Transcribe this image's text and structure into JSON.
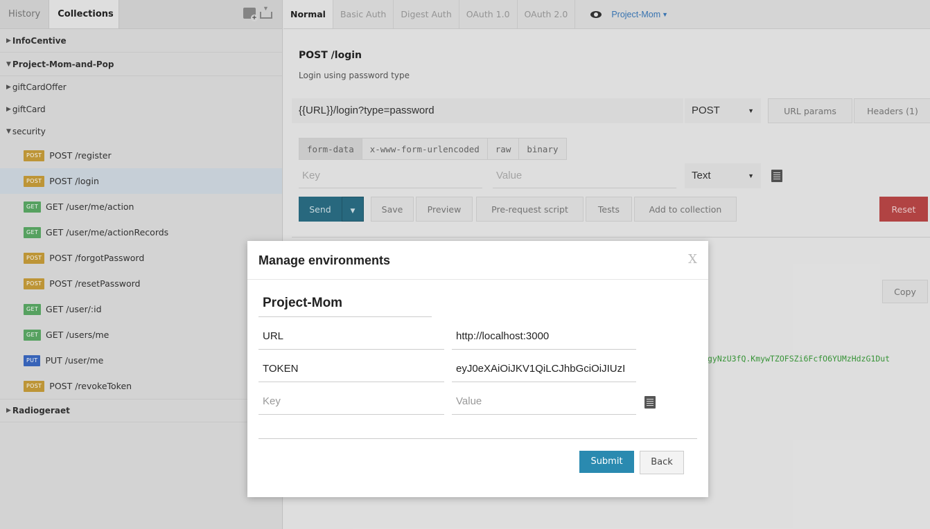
{
  "sidebar": {
    "tabs": {
      "history": "History",
      "collections": "Collections"
    },
    "collections": [
      {
        "name": "InfoCentive"
      },
      {
        "name": "Project-Mom-and-Pop"
      }
    ],
    "folders": [
      "giftCardOffer",
      "giftCard",
      "security"
    ],
    "requests": [
      {
        "method": "POST",
        "label": "POST /register"
      },
      {
        "method": "POST",
        "label": "POST /login"
      },
      {
        "method": "GET",
        "label": "GET /user/me/action"
      },
      {
        "method": "GET",
        "label": "GET /user/me/actionRecords"
      },
      {
        "method": "POST",
        "label": "POST /forgotPassword"
      },
      {
        "method": "POST",
        "label": "POST /resetPassword"
      },
      {
        "method": "GET",
        "label": "GET /user/:id"
      },
      {
        "method": "GET",
        "label": "GET /users/me"
      },
      {
        "method": "PUT",
        "label": "PUT /user/me"
      },
      {
        "method": "POST",
        "label": "POST /revokeToken"
      }
    ],
    "last_collection": "Radiogeraet"
  },
  "auth_tabs": [
    "Normal",
    "Basic Auth",
    "Digest Auth",
    "OAuth 1.0",
    "OAuth 2.0"
  ],
  "environment": {
    "selected": "Project-Mom"
  },
  "request": {
    "title": "POST /login",
    "description": "Login using password type",
    "url": "{{URL}}/login?type=password",
    "method": "POST",
    "url_params_label": "URL params",
    "headers_label": "Headers (1)"
  },
  "body_tabs": [
    "form-data",
    "x-www-form-urlencoded",
    "raw",
    "binary"
  ],
  "form": {
    "key_placeholder": "Key",
    "value_placeholder": "Value",
    "type": "Text"
  },
  "actions": {
    "send": "Send",
    "save": "Save",
    "preview": "Preview",
    "prerequest": "Pre-request script",
    "tests": "Tests",
    "add_to_collection": "Add to collection",
    "reset": "Reset"
  },
  "response": {
    "copy": "Copy",
    "token_fragment": "gyNzU3fQ.KmywTZOFSZi6FcfO6YUMzHdzG1Dut"
  },
  "modal": {
    "title": "Manage environments",
    "close": "X",
    "env_name": "Project-Mom",
    "rows": [
      {
        "key": "URL",
        "value": "http://localhost:3000"
      },
      {
        "key": "TOKEN",
        "value": "eyJ0eXAiOiJKV1QiLCJhbGciOiJIUzI"
      }
    ],
    "key_placeholder": "Key",
    "value_placeholder": "Value",
    "submit": "Submit",
    "back": "Back"
  }
}
